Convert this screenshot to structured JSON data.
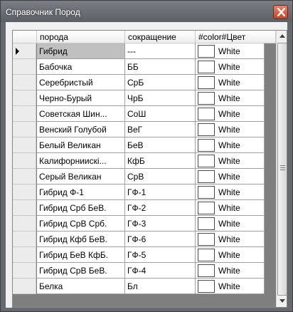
{
  "window": {
    "title": "Справочник Пород",
    "close_icon": "close-icon"
  },
  "grid": {
    "columns": [
      "порода",
      "сокращение",
      "#color#Цвет"
    ],
    "selected_row": 0,
    "rows": [
      {
        "name": "Гибрид",
        "abbr": "---",
        "color": "White"
      },
      {
        "name": "Бабочка",
        "abbr": "ББ",
        "color": "White"
      },
      {
        "name": "Серебристый",
        "abbr": "СрБ",
        "color": "White"
      },
      {
        "name": "Черно-Бурый",
        "abbr": "ЧрБ",
        "color": "White"
      },
      {
        "name": "Советская Шин...",
        "abbr": "СоШ",
        "color": "White"
      },
      {
        "name": "Венский Голубой",
        "abbr": "ВеГ",
        "color": "White"
      },
      {
        "name": "Белый Великан",
        "abbr": "БеВ",
        "color": "White"
      },
      {
        "name": "Калифорниискі...",
        "abbr": "КфБ",
        "color": "White"
      },
      {
        "name": "Серый Великан",
        "abbr": "СрВ",
        "color": "White"
      },
      {
        "name": "Гибрид  Ф-1",
        "abbr": "ГФ-1",
        "color": "White"
      },
      {
        "name": "Гибрид Срб БеВ.",
        "abbr": "ГФ-2",
        "color": "White"
      },
      {
        "name": "Гибрид СрВ Срб.",
        "abbr": "ГФ-3",
        "color": "White"
      },
      {
        "name": "Гибрид Кфб БеВ.",
        "abbr": "ГФ-6",
        "color": "White"
      },
      {
        "name": "Гибрид БеВ КфБ.",
        "abbr": "ГФ-5",
        "color": "White"
      },
      {
        "name": "Гибрид СрВ БеВ.",
        "abbr": "ГФ-4",
        "color": "White"
      },
      {
        "name": "Белка",
        "abbr": "Бл",
        "color": "White"
      }
    ]
  },
  "colors": {
    "swatch": "#ffffff",
    "selected_cell": "#c0c0c0",
    "grid_background": "#7f7f7f"
  }
}
